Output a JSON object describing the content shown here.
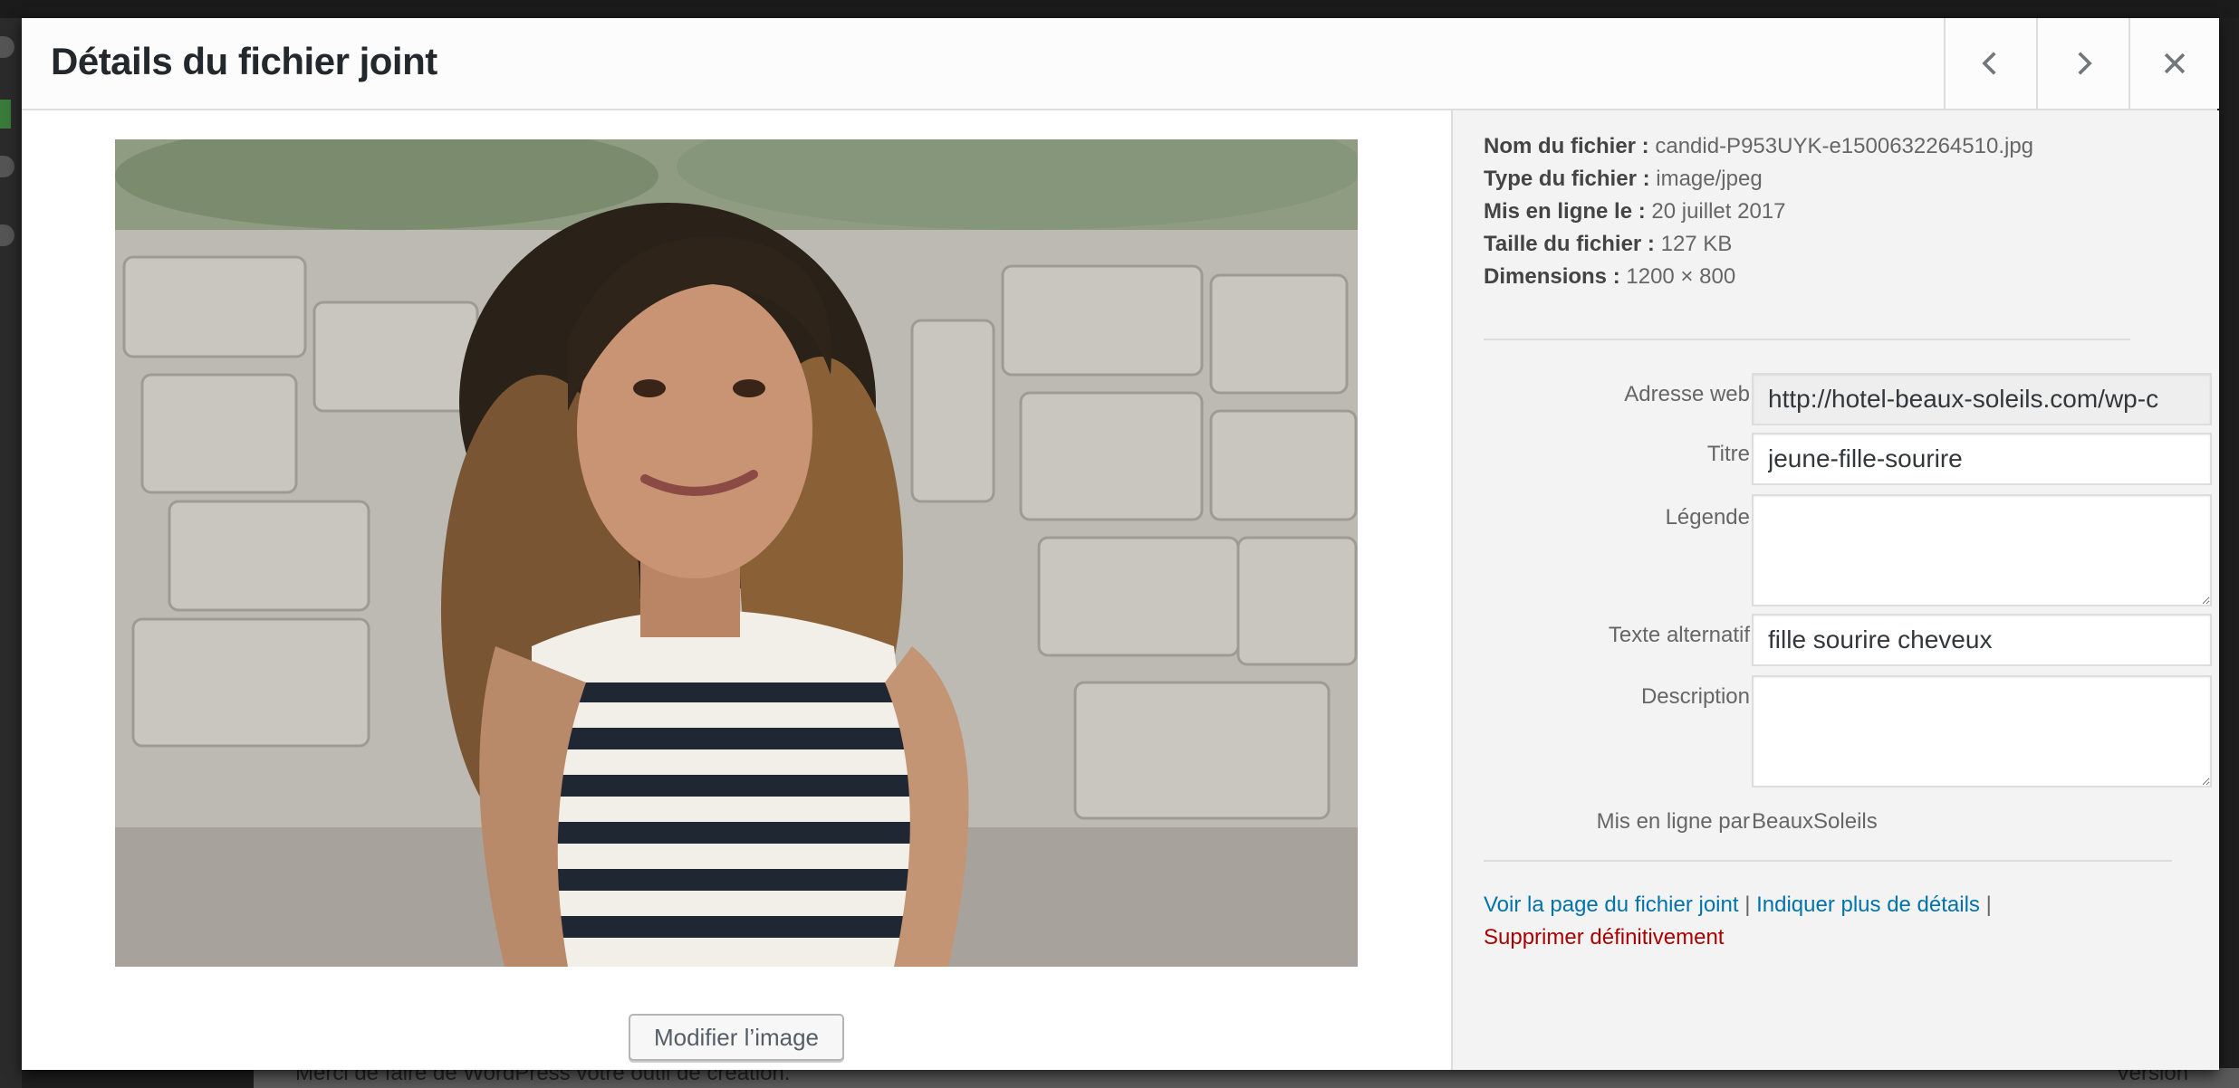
{
  "modal": {
    "title": "Détails du fichier joint"
  },
  "header_buttons": {
    "previous_icon": "chevron-left-icon",
    "next_icon": "chevron-right-icon",
    "close_icon": "close-icon"
  },
  "media": {
    "photo_description": "photo of smiling young woman with curly hair in striped top",
    "edit_button_label": "Modifier l’image"
  },
  "meta": {
    "filename_label": "Nom du fichier :",
    "filename": "candid-P953UYK-e1500632264510.jpg",
    "filetype_label": "Type du fichier :",
    "filetype": "image/jpeg",
    "uploaded_label": "Mis en ligne le :",
    "uploaded": "20 juillet 2017",
    "filesize_label": "Taille du fichier :",
    "filesize": "127 KB",
    "dimensions_label": "Dimensions :",
    "dimensions": "1200 × 800"
  },
  "fields": {
    "url_label": "Adresse web",
    "url_value": "http://hotel-beaux-soleils.com/wp-c",
    "title_label": "Titre",
    "title_value": "jeune-fille-sourire",
    "caption_label": "Légende",
    "caption_value": "",
    "alt_label": "Texte alternatif",
    "alt_value": "fille sourire cheveux",
    "description_label": "Description",
    "description_value": "",
    "uploaded_by_label": "Mis en ligne par",
    "uploaded_by_value": "BeauxSoleils"
  },
  "actions": {
    "view_page": "Voir la page du fichier joint",
    "more_details": "Indiquer plus de détails",
    "separator": "|",
    "delete": "Supprimer définitivement"
  },
  "background": {
    "footer_text": "Merci de faire de WordPress votre outil de création.",
    "version_text": "Version"
  },
  "colors": {
    "link": "#0073aa",
    "danger": "#aa0000",
    "panel_bg": "#f3f3f3"
  }
}
